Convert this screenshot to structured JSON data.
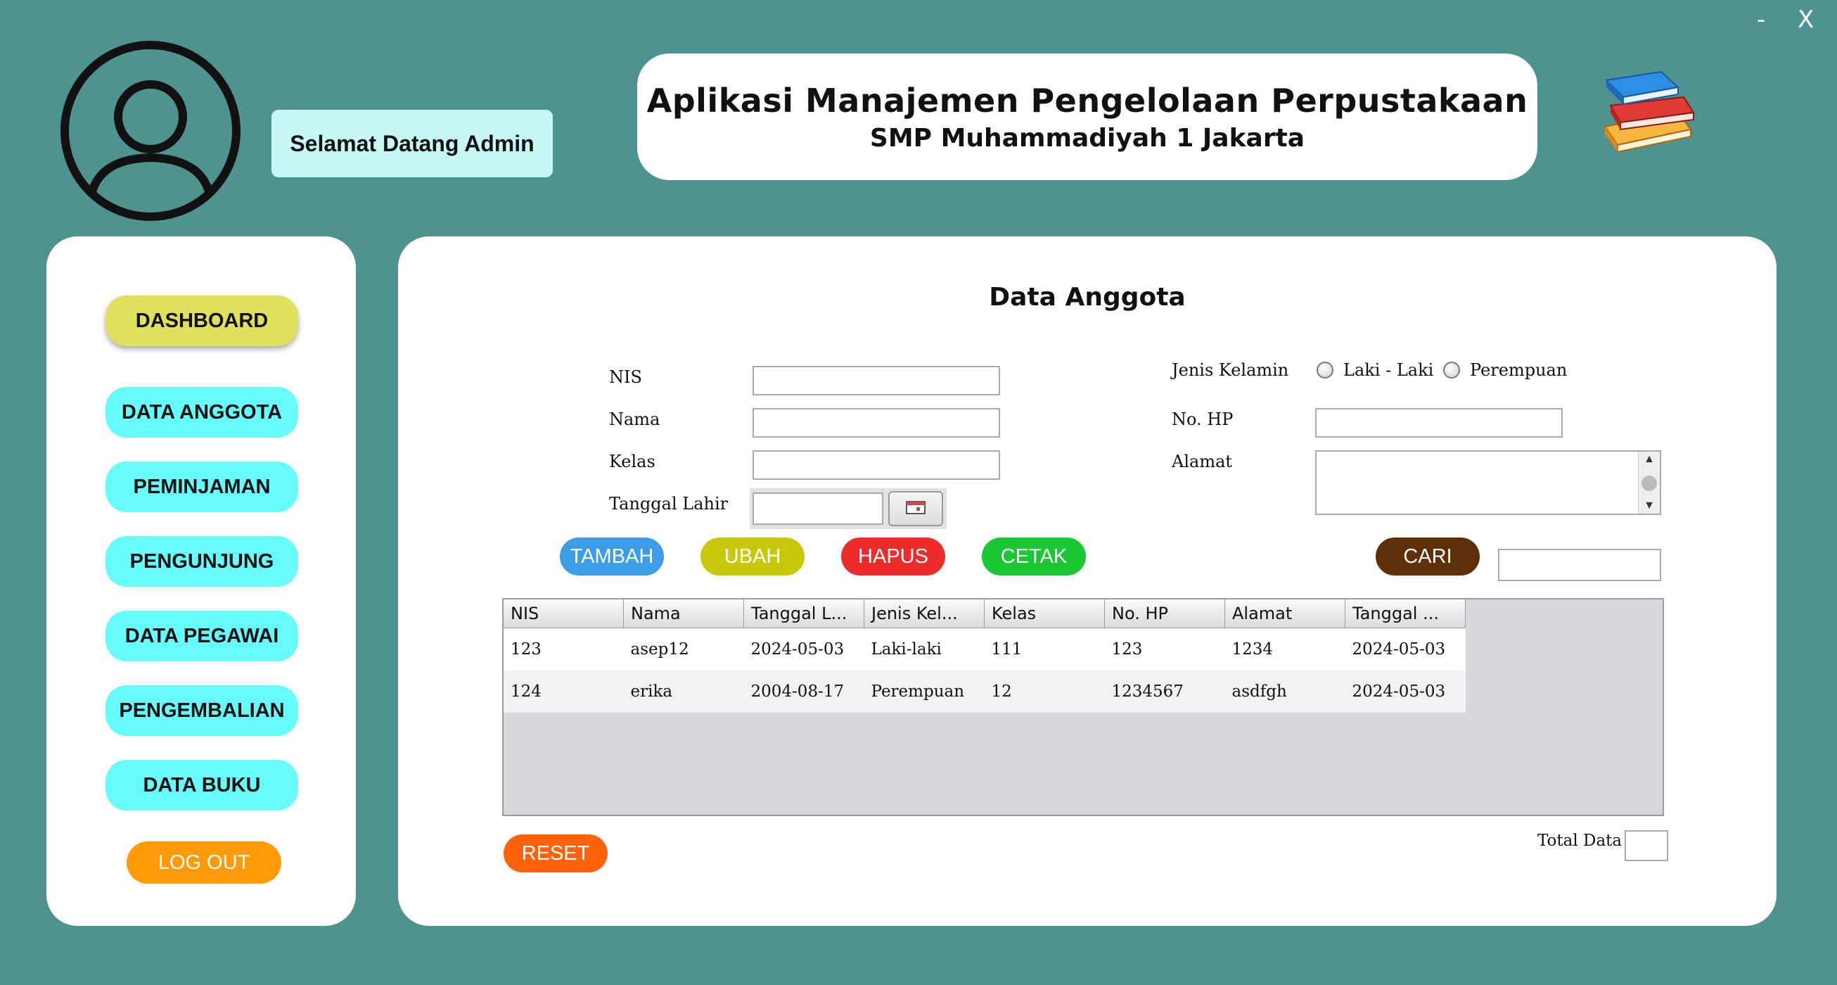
{
  "window": {
    "minimize_label": "-",
    "close_label": "X"
  },
  "header": {
    "welcome": "Selamat Datang Admin",
    "title": "Aplikasi Manajemen Pengelolaan Perpustakaan",
    "subtitle": "SMP Muhammadiyah 1 Jakarta",
    "avatar_icon": "user-avatar-icon",
    "logo_icon": "books-icon"
  },
  "sidebar": {
    "items": [
      {
        "label": "DASHBOARD",
        "active": true
      },
      {
        "label": "DATA ANGGOTA"
      },
      {
        "label": "PEMINJAMAN"
      },
      {
        "label": "PENGUNJUNG"
      },
      {
        "label": "DATA PEGAWAI"
      },
      {
        "label": "PENGEMBALIAN"
      },
      {
        "label": "DATA BUKU"
      }
    ],
    "logout": "LOG OUT"
  },
  "form": {
    "title": "Data Anggota",
    "nis_label": "NIS",
    "nama_label": "Nama",
    "kelas_label": "Kelas",
    "tgl_label": "Tanggal Lahir",
    "jk_label": "Jenis Kelamin",
    "jk_options": [
      "Laki - Laki",
      "Perempuan"
    ],
    "hp_label": "No. HP",
    "alamat_label": "Alamat",
    "nis_value": "",
    "nama_value": "",
    "kelas_value": "",
    "tgl_value": "",
    "hp_value": "",
    "search_value": ""
  },
  "actions": {
    "tambah": "TAMBAH",
    "ubah": "UBAH",
    "hapus": "HAPUS",
    "cetak": "CETAK",
    "cari": "CARI",
    "reset": "RESET"
  },
  "table": {
    "columns": [
      "NIS",
      "Nama",
      "Tanggal L...",
      "Jenis Kel...",
      "Kelas",
      "No. HP",
      "Alamat",
      "Tanggal ..."
    ],
    "rows": [
      [
        "123",
        "asep12",
        "2024-05-03",
        "Laki-laki",
        "111",
        "123",
        "1234",
        "2024-05-03"
      ],
      [
        "124",
        "erika",
        "2004-08-17",
        "Perempuan",
        "12",
        "1234567",
        "asdfgh",
        "2024-05-03"
      ]
    ]
  },
  "footer": {
    "total_label": "Total Data",
    "total_value": ""
  },
  "colors": {
    "background": "#4f9391",
    "nav_button": "#66fcfc",
    "nav_active": "#e0e05c",
    "logout": "#ff9a08",
    "tambah": "#3d9ce8",
    "ubah": "#c8c80a",
    "hapus": "#ee2b2b",
    "cetak": "#19c832",
    "cari": "#5d3008",
    "reset": "#ff620a"
  }
}
